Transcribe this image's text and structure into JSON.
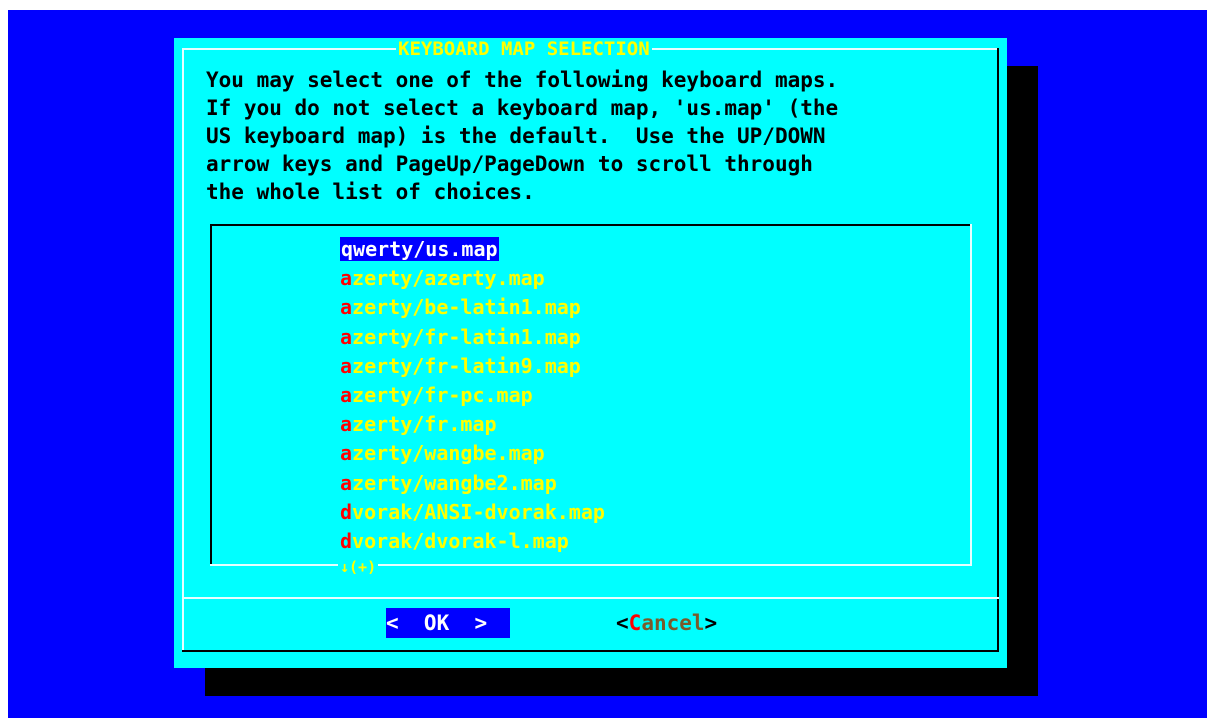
{
  "dialog": {
    "title": "KEYBOARD MAP SELECTION",
    "intro_lines": [
      "You may select one of the following keyboard maps.",
      "If you do not select a keyboard map, 'us.map' (the",
      "US keyboard map) is the default.  Use the UP/DOWN",
      "arrow keys and PageUp/PageDown to scroll through",
      "the whole list of choices."
    ]
  },
  "list": {
    "selected_index": 0,
    "items": [
      {
        "hot": "q",
        "rest": "werty/us.map"
      },
      {
        "hot": "a",
        "rest": "zerty/azerty.map"
      },
      {
        "hot": "a",
        "rest": "zerty/be-latin1.map"
      },
      {
        "hot": "a",
        "rest": "zerty/fr-latin1.map"
      },
      {
        "hot": "a",
        "rest": "zerty/fr-latin9.map"
      },
      {
        "hot": "a",
        "rest": "zerty/fr-pc.map"
      },
      {
        "hot": "a",
        "rest": "zerty/fr.map"
      },
      {
        "hot": "a",
        "rest": "zerty/wangbe.map"
      },
      {
        "hot": "a",
        "rest": "zerty/wangbe2.map"
      },
      {
        "hot": "d",
        "rest": "vorak/ANSI-dvorak.map"
      },
      {
        "hot": "d",
        "rest": "vorak/dvorak-l.map"
      }
    ],
    "scroll_indicator": "↓(+)"
  },
  "buttons": {
    "ok_label": "<  OK  >",
    "cancel_open": "<",
    "cancel_hot": "C",
    "cancel_rest": "ancel",
    "cancel_close": ">"
  },
  "colors": {
    "screen_bg": "#0000ff",
    "dialog_bg": "#00ffff",
    "title": "#ffff00",
    "item_text": "#ffff00",
    "hotkey": "#ff0000",
    "selection_bg": "#0000ff"
  }
}
